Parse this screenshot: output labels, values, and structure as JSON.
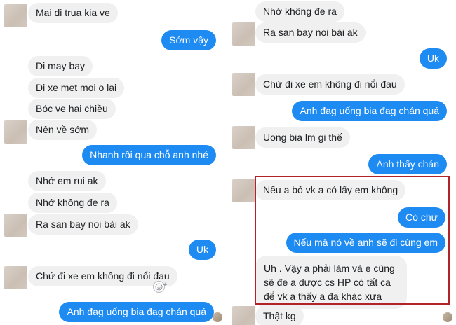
{
  "left_panel": {
    "messages": [
      {
        "side": "in",
        "text": "Mai di trua kia ve"
      },
      {
        "side": "out",
        "text": "Sớm vậy"
      },
      {
        "side": "in",
        "text": "Di may bay"
      },
      {
        "side": "in",
        "text": "Di xe met moi o lai"
      },
      {
        "side": "in",
        "text": "Bóc ve hai chiều"
      },
      {
        "side": "in",
        "text": "Nên về sớm"
      },
      {
        "side": "out",
        "text": "Nhanh rồi qua chỗ anh nhé"
      },
      {
        "side": "in",
        "text": "Nhớ em rui ak"
      },
      {
        "side": "in",
        "text": "Nhớ không đe ra"
      },
      {
        "side": "in",
        "text": "Ra san bay noi bài ak"
      },
      {
        "side": "out",
        "text": "Uk"
      },
      {
        "side": "in",
        "text": "Chứ đi xe em không đi nổi đau"
      },
      {
        "side": "out",
        "text": "Anh đag uống bia đag chán quá"
      }
    ]
  },
  "right_panel": {
    "messages": [
      {
        "side": "in",
        "text": "Nhớ không đe ra"
      },
      {
        "side": "in",
        "text": "Ra san bay noi bài ak"
      },
      {
        "side": "out",
        "text": "Uk"
      },
      {
        "side": "in",
        "text": "Chứ đi xe em không đi nổi đau"
      },
      {
        "side": "out",
        "text": "Anh đag uống bia đag chán quá"
      },
      {
        "side": "in",
        "text": "Uong bia lm gi thế"
      },
      {
        "side": "out",
        "text": "Anh thấy chán"
      },
      {
        "side": "in",
        "text": "Nếu a bỏ vk a có lấy em không"
      },
      {
        "side": "out",
        "text": "Có chứ"
      },
      {
        "side": "out",
        "text": "Nếu mà nó về anh sẽ đi cùng em"
      },
      {
        "side": "in",
        "text": "Uh . Vậy a phải làm và e cũng sẽ đe a dược cs HP có tất ca để vk a thấy a đa khác xưa"
      },
      {
        "side": "in",
        "text": "Thật kg"
      }
    ]
  },
  "colors": {
    "outgoing_bubble": "#1d8bf1",
    "incoming_bubble": "#f0f0f0",
    "highlight_border": "#b3212a"
  },
  "icons": {
    "reaction": "smiley-plus-icon"
  }
}
